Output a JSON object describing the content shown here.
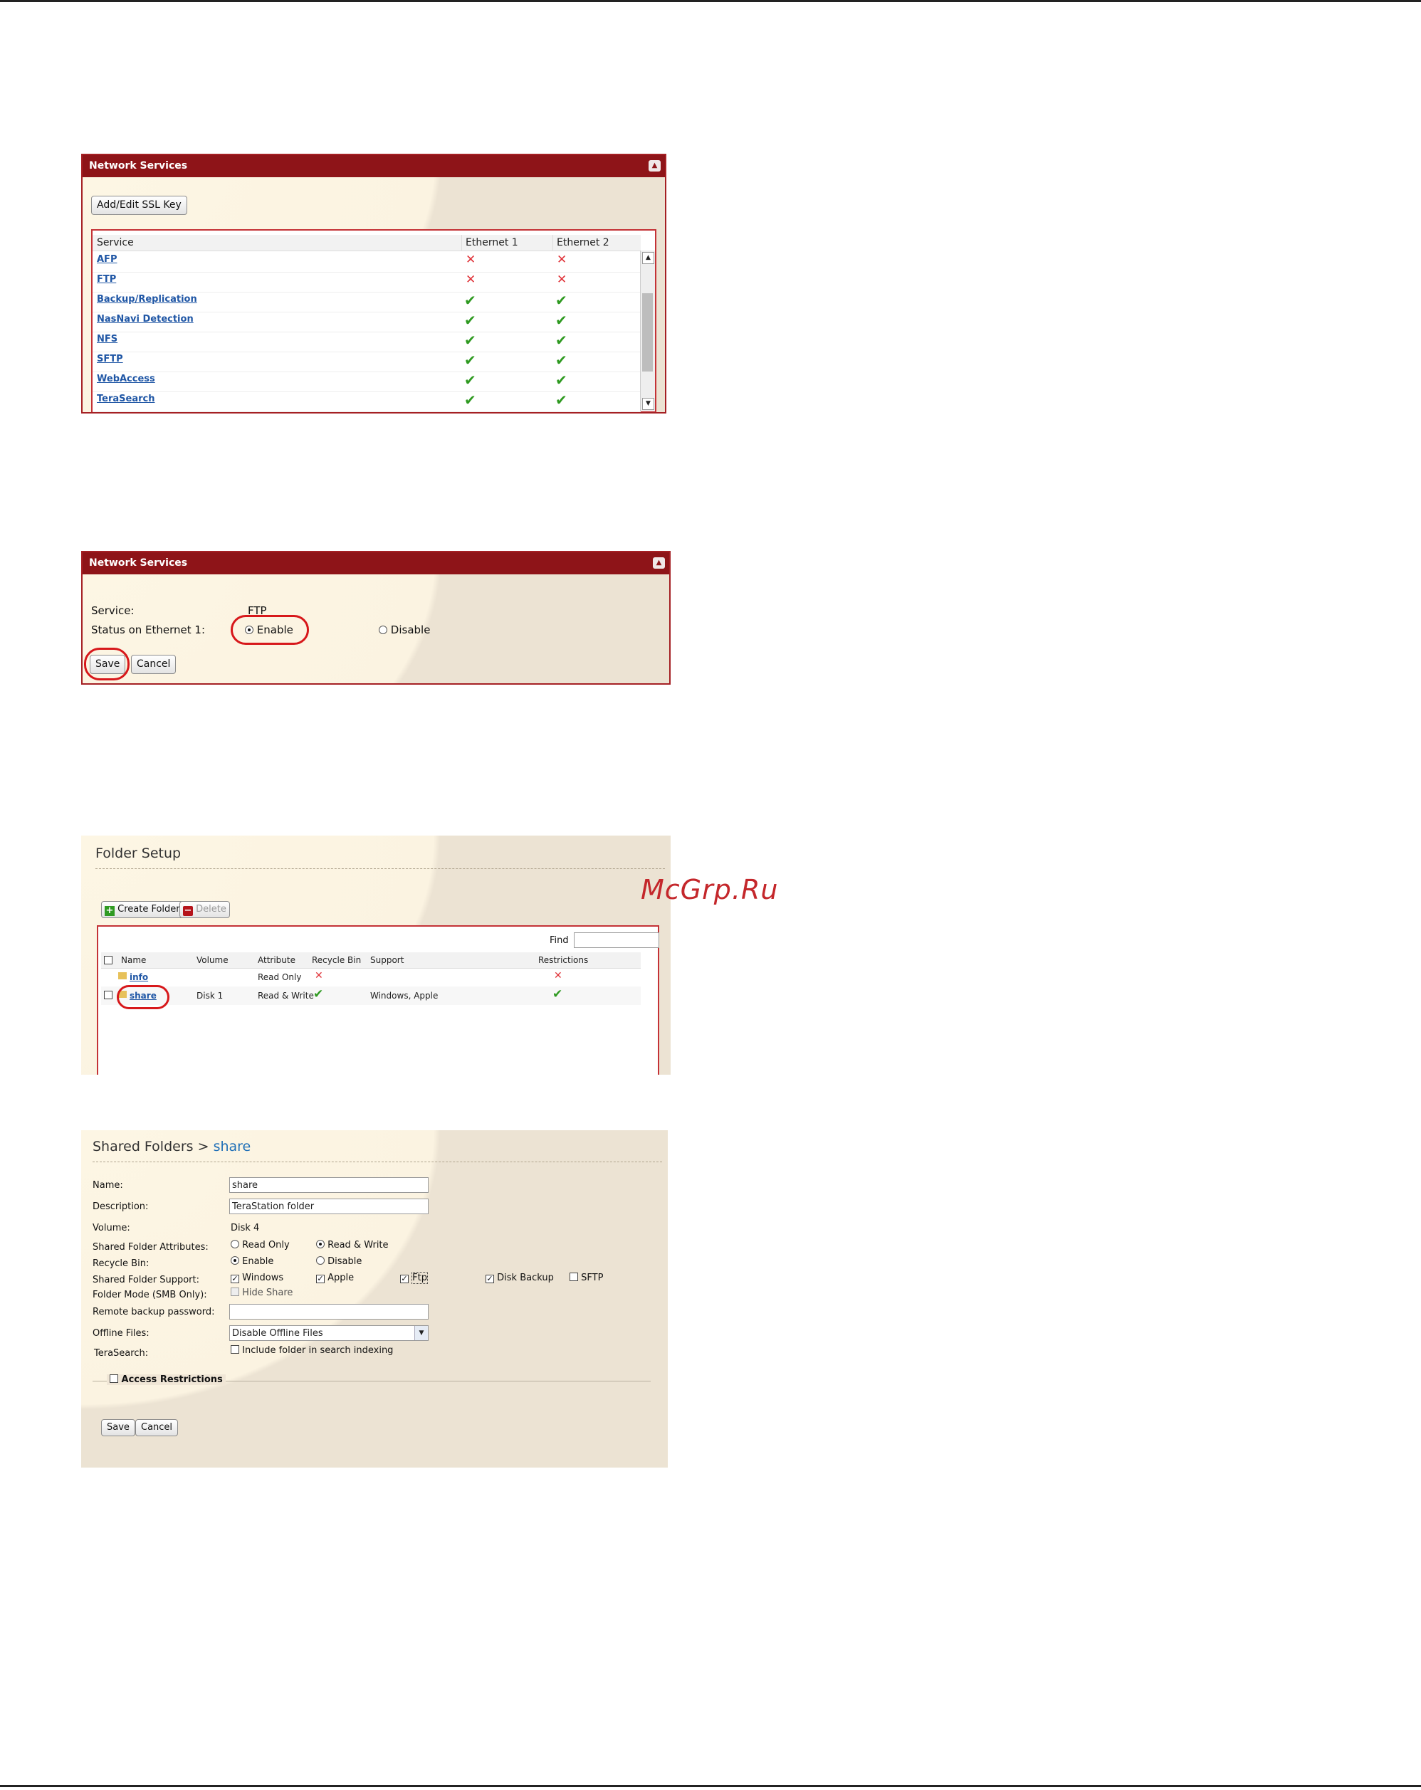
{
  "watermark": "McGrp.Ru",
  "panel1": {
    "title": "Network Services",
    "ssl_button": "Add/Edit SSL Key",
    "columns": [
      "Service",
      "Ethernet 1",
      "Ethernet 2"
    ],
    "rows": [
      {
        "service": "AFP",
        "eth1": "x",
        "eth2": "x"
      },
      {
        "service": "FTP",
        "eth1": "x",
        "eth2": "x"
      },
      {
        "service": "Backup/Replication",
        "eth1": "ok",
        "eth2": "ok"
      },
      {
        "service": "NasNavi Detection",
        "eth1": "ok",
        "eth2": "ok"
      },
      {
        "service": "NFS",
        "eth1": "ok",
        "eth2": "ok"
      },
      {
        "service": "SFTP",
        "eth1": "ok",
        "eth2": "ok"
      },
      {
        "service": "WebAccess",
        "eth1": "ok",
        "eth2": "ok"
      },
      {
        "service": "TeraSearch",
        "eth1": "ok",
        "eth2": "ok"
      }
    ]
  },
  "panel2": {
    "title": "Network Services",
    "service_label": "Service:",
    "service_value": "FTP",
    "status_label": "Status on Ethernet 1:",
    "enable": "Enable",
    "disable": "Disable",
    "save": "Save",
    "cancel": "Cancel"
  },
  "panel3": {
    "title": "Folder Setup",
    "create": "Create Folder",
    "delete": "Delete",
    "find": "Find",
    "columns": [
      "Name",
      "Volume",
      "Attribute",
      "Recycle Bin",
      "Support",
      "Restrictions"
    ],
    "rows": [
      {
        "name": "info",
        "volume": "",
        "attribute": "Read Only",
        "recycle": "x",
        "support": "",
        "restrictions": "x"
      },
      {
        "name": "share",
        "volume": "Disk 1",
        "attribute": "Read & Write",
        "recycle": "ok",
        "support": "Windows, Apple",
        "restrictions": "ok"
      }
    ]
  },
  "panel4": {
    "breadcrumb_root": "Shared Folders",
    "breadcrumb_sep": ">",
    "breadcrumb_current": "share",
    "name_label": "Name:",
    "name_value": "share",
    "desc_label": "Description:",
    "desc_value": "TeraStation folder",
    "volume_label": "Volume:",
    "volume_value": "Disk 4",
    "attr_label": "Shared Folder Attributes:",
    "read_only": "Read Only",
    "read_write": "Read & Write",
    "recycle_label": "Recycle Bin:",
    "enable": "Enable",
    "disable": "Disable",
    "support_label": "Shared Folder Support:",
    "windows": "Windows",
    "apple": "Apple",
    "ftp": "Ftp",
    "disk_backup": "Disk Backup",
    "sftp": "SFTP",
    "mode_label": "Folder Mode (SMB Only):",
    "hide_share": "Hide Share",
    "remote_label": "Remote backup password:",
    "offline_label": "Offline Files:",
    "offline_value": "Disable Offline Files",
    "terasearch_label": "TeraSearch:",
    "include_label": "Include folder in search indexing",
    "access_label": "Access Restrictions",
    "save": "Save",
    "cancel": "Cancel"
  }
}
